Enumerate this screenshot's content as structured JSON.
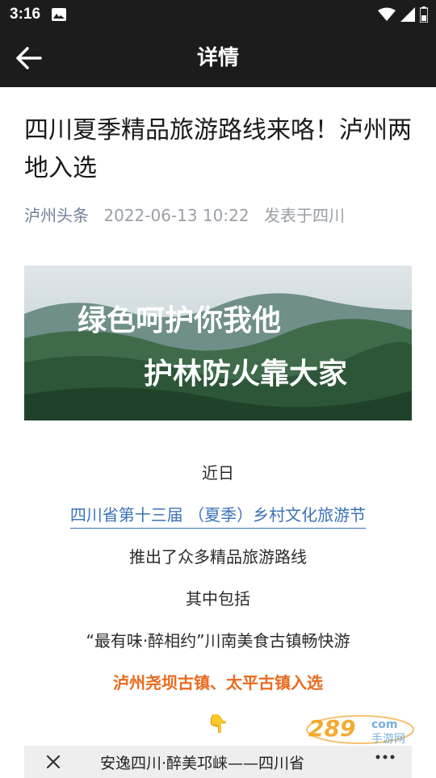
{
  "status_bar": {
    "time": "3:16"
  },
  "app_bar": {
    "title": "详情"
  },
  "article": {
    "title": "四川夏季精品旅游路线来咯！泸州两地入选",
    "source": "泸州头条",
    "date": "2022-06-13 10:22",
    "location": "发表于四川",
    "banner": {
      "line1": "绿色呵护你我他",
      "line2": "护林防火靠大家"
    },
    "lines": [
      "近日",
      "四川省第十三届 （夏季）乡村文化旅游节",
      "推出了众多精品旅游路线",
      "其中包括",
      "“最有味·醉相约”川南美食古镇畅快游",
      "泸州尧坝古镇、太平古镇入选"
    ],
    "pointer_emoji": "👇"
  },
  "watermark": {
    "brand": "289",
    "suffix": "com",
    "tagline": "手游网"
  },
  "mini_bar": {
    "title": "安逸四川·醉美邛崃——四川省"
  },
  "colors": {
    "bar_bg": "#1c1c1c",
    "link": "#3b73b9",
    "highlight": "#ea6a1e",
    "meta": "#9aa0a6"
  }
}
